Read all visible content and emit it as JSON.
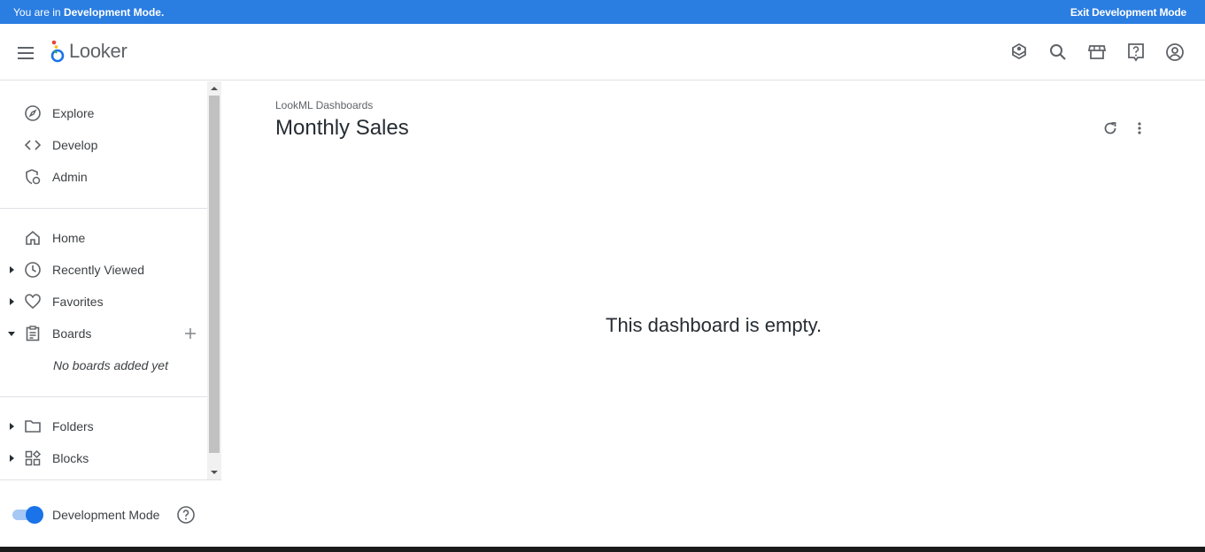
{
  "devbar": {
    "prefix": "You are in ",
    "mode": "Development Mode.",
    "exit": "Exit Development Mode"
  },
  "header": {
    "brand": "Looker",
    "icons": [
      "menu-icon",
      "marketplace-box-icon",
      "search-icon",
      "store-icon",
      "help-icon",
      "account-icon"
    ]
  },
  "sidebar": {
    "primary": [
      {
        "label": "Explore",
        "icon": "compass-icon"
      },
      {
        "label": "Develop",
        "icon": "code-icon"
      },
      {
        "label": "Admin",
        "icon": "admin-shield-icon"
      }
    ],
    "content": [
      {
        "label": "Home",
        "icon": "home-icon"
      },
      {
        "label": "Recently Viewed",
        "icon": "clock-icon"
      },
      {
        "label": "Favorites",
        "icon": "heart-icon"
      },
      {
        "label": "Boards",
        "icon": "clipboard-icon"
      }
    ],
    "boards_empty": "No boards added yet",
    "library": [
      {
        "label": "Folders",
        "icon": "folder-icon"
      },
      {
        "label": "Blocks",
        "icon": "blocks-icon"
      }
    ],
    "dev_mode_label": "Development Mode",
    "dev_mode_on": true
  },
  "main": {
    "breadcrumb": "LookML Dashboards",
    "title": "Monthly Sales",
    "empty_message": "This dashboard is empty."
  },
  "colors": {
    "devbar": "#2a7de1",
    "accent": "#1a73e8",
    "text": "#262d33",
    "icon": "#5f6368"
  }
}
